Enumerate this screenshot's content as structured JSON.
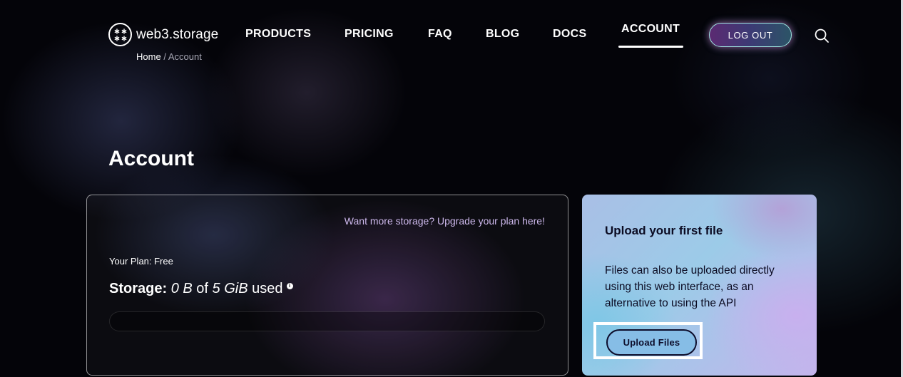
{
  "header": {
    "logo_text": "web3.storage",
    "nav": [
      {
        "label": "PRODUCTS"
      },
      {
        "label": "PRICING"
      },
      {
        "label": "FAQ"
      },
      {
        "label": "BLOG"
      },
      {
        "label": "DOCS"
      },
      {
        "label": "ACCOUNT",
        "active": true
      }
    ],
    "logout_label": "LOG OUT",
    "search_icon": "search-icon",
    "logo_icon": "web3-storage-logo-icon"
  },
  "breadcrumb": {
    "home": "Home",
    "separator": "/",
    "current": "Account"
  },
  "page_title": "Account",
  "storage_card": {
    "upgrade_link": "Want more storage? Upgrade your plan here!",
    "plan_label": "Your Plan: Free",
    "storage_label": "Storage:",
    "used_value": "0 B",
    "of_text": "of",
    "total_value": "5 GiB",
    "used_text": "used",
    "info_icon": "info-icon",
    "usage_fraction": 0
  },
  "upload_card": {
    "title": "Upload your first file",
    "description": "Files can also be uploaded directly using this web interface, as an alternative to using the API",
    "button_label": "Upload Files"
  },
  "colors": {
    "background": "#040409",
    "upgrade_link": "#cdb8ec",
    "upload_button": "#86bde6",
    "logout_border": "#9fe6e0"
  }
}
